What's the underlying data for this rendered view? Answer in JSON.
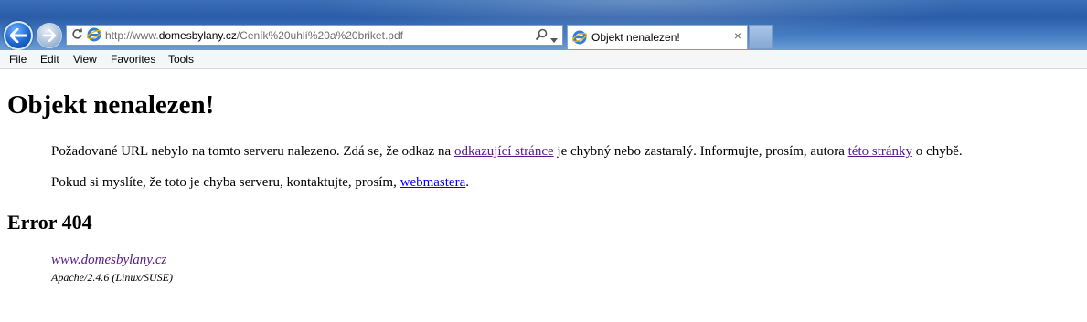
{
  "browser": {
    "url": {
      "prefix": "http://www.",
      "domain": "domesbylany.cz",
      "path": "/Ceník%20uhlí%20a%20briket.pdf"
    },
    "tab": {
      "title": "Objekt nenalezen!",
      "close_glyph": "×"
    },
    "icons": {
      "back": "back-arrow-icon",
      "forward": "forward-arrow-icon",
      "refresh": "refresh-icon",
      "favicon": "internet-explorer-icon",
      "search": "search-icon",
      "dropdown": "chevron-down-icon",
      "close": "close-icon"
    },
    "colors": {
      "chrome": "#2a5da8",
      "back_button": "#1b66d1",
      "visited_link": "#551a8b",
      "link": "#0000ee"
    }
  },
  "menu": {
    "items": [
      "File",
      "Edit",
      "View",
      "Favorites",
      "Tools"
    ]
  },
  "page": {
    "title": "Objekt nenalezen!",
    "paragraph1": {
      "before_link1": "Požadované URL nebylo na tomto serveru nalezeno. Zdá se, že odkaz na ",
      "link1": "odkazující stránce",
      "middle": " je chybný nebo zastaralý. Informujte, prosím, autora ",
      "link2": "této stránky",
      "after": " o chybě."
    },
    "paragraph2": {
      "before_link": "Pokud si myslíte, že toto je chyba serveru, kontaktujte, prosím, ",
      "link": "webmastera",
      "after": "."
    },
    "error_heading": "Error 404",
    "address": {
      "link": "www.domesbylany.cz",
      "server": "Apache/2.4.6 (Linux/SUSE)"
    }
  }
}
